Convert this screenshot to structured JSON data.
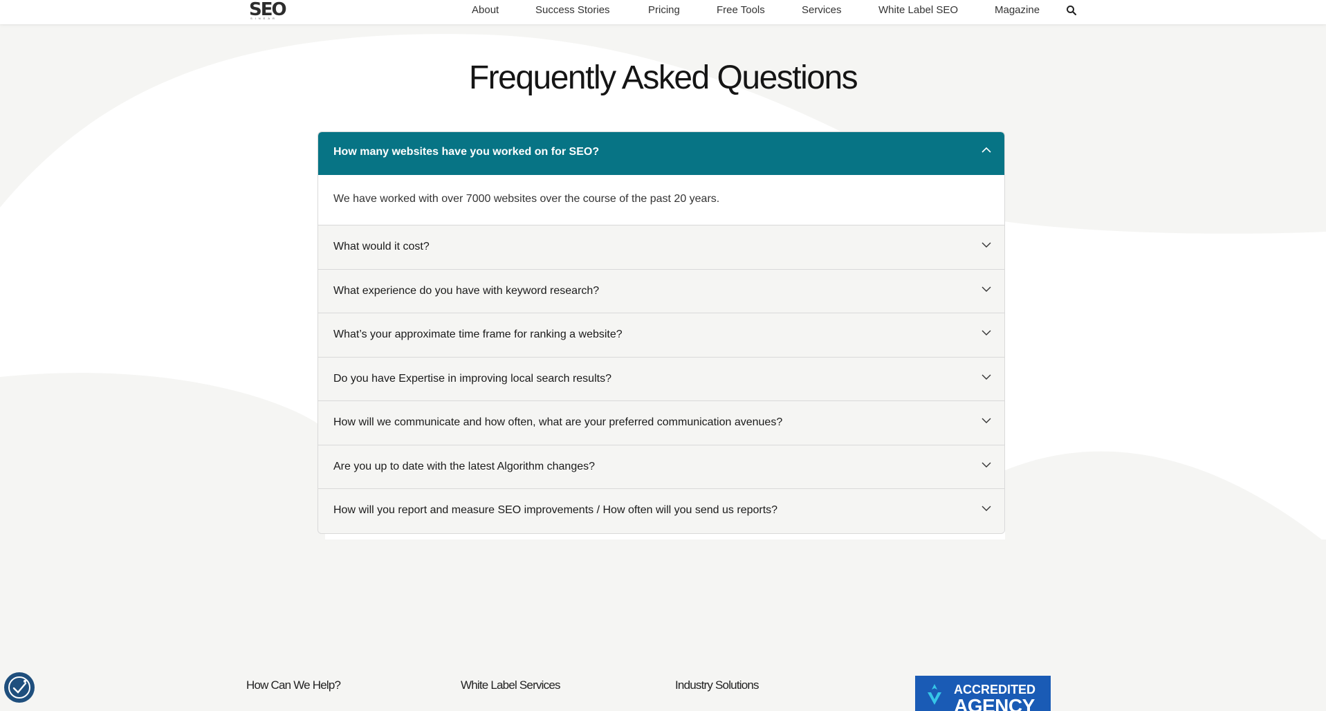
{
  "header": {
    "logo_text": "SEO",
    "logo_sub": "SINEAR",
    "nav": [
      "About",
      "Success Stories",
      "Pricing",
      "Free Tools",
      "Services",
      "White Label SEO",
      "Magazine"
    ],
    "search_icon": "search-icon"
  },
  "page": {
    "title": "Frequently Asked Questions"
  },
  "faq": {
    "open_question": "How many websites have you worked on for SEO?",
    "open_answer": "We have worked with over 7000 websites over the course of the past 20 years.",
    "questions": [
      "What would it cost?",
      "What experience do you have with keyword research?",
      "What’s your approximate time frame for ranking a website?",
      "Do you have Expertise in improving local search results?",
      "How will we communicate and how often, what are your preferred communication avenues?",
      "Are you up to date with the latest Algorithm changes?",
      "How will you report and measure SEO improvements / How often will you send us reports?"
    ],
    "accent_color": "#077485"
  },
  "footer": {
    "links": [
      "How Can We Help?",
      "White Label Services",
      "Industry Solutions"
    ],
    "badge_line1": "ACCREDITED",
    "badge_line2": "AGENCY",
    "badge_color": "#1a5bb5",
    "accessibility_icon": "accessibility-icon"
  }
}
